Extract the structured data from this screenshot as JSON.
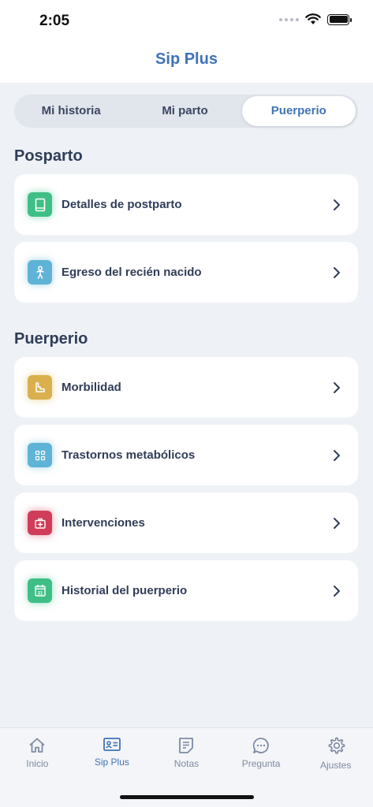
{
  "status": {
    "time": "2:05"
  },
  "header": {
    "title": "Sip Plus"
  },
  "segments": [
    {
      "label": "Mi historia"
    },
    {
      "label": "Mi parto"
    },
    {
      "label": "Puerperio"
    }
  ],
  "sections": {
    "posparto": {
      "title": "Posparto",
      "items": [
        {
          "label": "Detalles de postparto",
          "icon": "book-icon",
          "color": "#3fbf85"
        },
        {
          "label": "Egreso del recién nacido",
          "icon": "baby-icon",
          "color": "#5fb3d6"
        }
      ]
    },
    "puerperio": {
      "title": "Puerperio",
      "items": [
        {
          "label": "Morbilidad",
          "icon": "bed-icon",
          "color": "#d9b04d"
        },
        {
          "label": "Trastornos metabólicos",
          "icon": "grid-icon",
          "color": "#5fb3d6"
        },
        {
          "label": "Intervenciones",
          "icon": "first-aid-kit-icon",
          "color": "#d03d58"
        },
        {
          "label": "Historial del puerperio",
          "icon": "calendar-icon",
          "color": "#3fbf85"
        }
      ]
    }
  },
  "calendar_day": "31",
  "tabbar": [
    {
      "label": "Inicio",
      "icon": "home-icon"
    },
    {
      "label": "Sip Plus",
      "icon": "id-card-icon"
    },
    {
      "label": "Notas",
      "icon": "notes-icon"
    },
    {
      "label": "Pregunta",
      "icon": "chat-bubble-icon"
    },
    {
      "label": "Ajustes",
      "icon": "gear-icon"
    }
  ],
  "colors": {
    "accent": "#3f73b8",
    "tab_inactive": "#7c8aa4"
  }
}
